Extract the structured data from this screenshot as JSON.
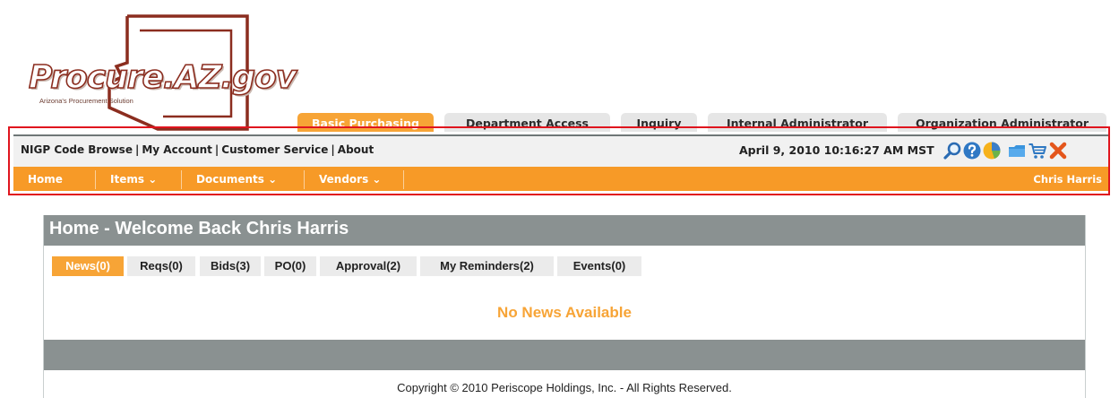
{
  "logo": {
    "text": "Procure.AZ.gov",
    "tagline": "Arizona's Procurement Solution"
  },
  "top_tabs": [
    {
      "label": "Basic Purchasing",
      "active": true
    },
    {
      "label": "Department Access",
      "active": false
    },
    {
      "label": "Inquiry",
      "active": false
    },
    {
      "label": "Internal Administrator",
      "active": false
    },
    {
      "label": "Organization Administrator",
      "active": false
    }
  ],
  "utility": {
    "links": [
      "NIGP Code Browse",
      "My Account",
      "Customer Service",
      "About"
    ],
    "separator": "|",
    "datetime": "April 9, 2010 10:16:27 AM MST",
    "icons": [
      "search-icon",
      "help-icon",
      "chart-icon",
      "folder-icon",
      "cart-icon",
      "close-icon"
    ]
  },
  "nav": {
    "items": [
      "Home",
      "Items",
      "Documents",
      "Vendors"
    ],
    "dropdown_marker": "⌄",
    "user": "Chris Harris"
  },
  "panel": {
    "title": "Home - Welcome Back Chris Harris",
    "tabs": [
      {
        "label": "News(0)",
        "active": true
      },
      {
        "label": "Reqs(0)",
        "active": false
      },
      {
        "label": "Bids(3)",
        "active": false
      },
      {
        "label": "PO(0)",
        "active": false
      },
      {
        "label": "Approval(2)",
        "active": false
      },
      {
        "label": "My Reminders(2)",
        "active": false
      },
      {
        "label": "Events(0)",
        "active": false
      }
    ],
    "empty_message": "No News Available"
  },
  "footer": {
    "copyright": "Copyright © 2010 Periscope Holdings, Inc. - All Rights Reserved."
  },
  "colors": {
    "accent_orange": "#f7a436",
    "nav_orange": "#f79a27",
    "header_gray": "#8a9191",
    "highlight_red": "#e0151e",
    "logo_maroon": "#8b2d1f"
  }
}
